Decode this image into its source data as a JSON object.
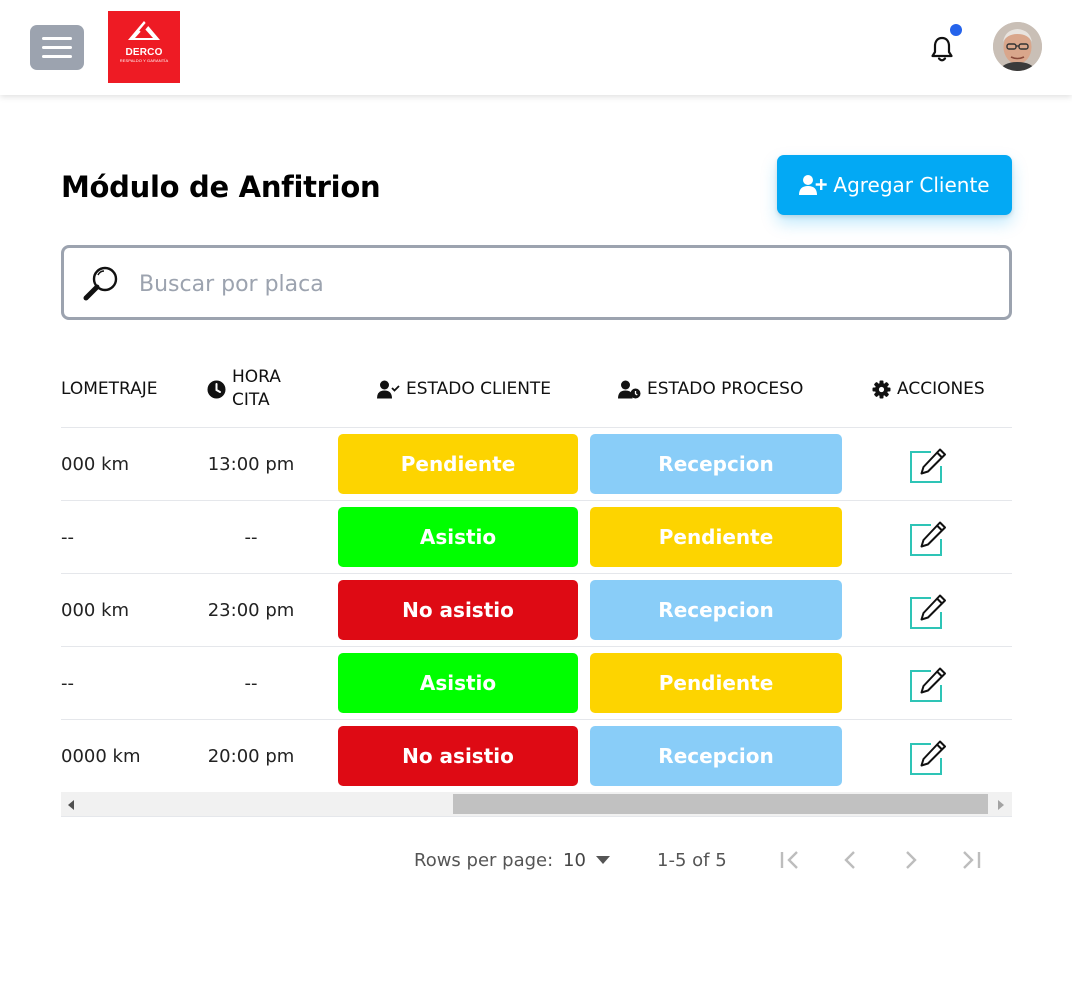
{
  "header": {
    "logo": {
      "name": "DERCO",
      "tagline": "RESPALDO Y GARANTÍA",
      "color": "#ee1b24"
    },
    "menu_icon": "hamburger-icon",
    "bell_icon": "bell-icon",
    "notification_dot_color": "#2563eb"
  },
  "main": {
    "title": "Módulo de Anfitrion",
    "add_button_label": "Agregar Cliente",
    "accent_color": "#03a9f4"
  },
  "search": {
    "placeholder": "Buscar por placa",
    "value": ""
  },
  "table": {
    "columns": {
      "kilometraje": "LOMETRAJE",
      "hora_cita_line1": "HORA",
      "hora_cita_line2": "CITA",
      "estado_cliente": "ESTADO CLIENTE",
      "estado_proceso": "ESTADO PROCESO",
      "acciones": "ACCIONES"
    },
    "rows": [
      {
        "km": "000 km",
        "hora": "13:00 pm",
        "estado_cliente": "Pendiente",
        "estado_proceso": "Recepcion"
      },
      {
        "km": "--",
        "hora": "--",
        "estado_cliente": "Asistio",
        "estado_proceso": "Pendiente"
      },
      {
        "km": "000 km",
        "hora": "23:00 pm",
        "estado_cliente": "No asistio",
        "estado_proceso": "Recepcion"
      },
      {
        "km": "--",
        "hora": "--",
        "estado_cliente": "Asistio",
        "estado_proceso": "Pendiente"
      },
      {
        "km": "0000 km",
        "hora": "20:00 pm",
        "estado_cliente": "No asistio",
        "estado_proceso": "Recepcion"
      }
    ],
    "status_colors": {
      "Pendiente": "#fdd400",
      "Asistio": "#00ff00",
      "No asistio": "#de0a14",
      "Recepcion": "#89cdf8"
    }
  },
  "pagination": {
    "rows_per_page_label": "Rows per page:",
    "rows_per_page_value": "10",
    "range": "1-5 of 5"
  }
}
